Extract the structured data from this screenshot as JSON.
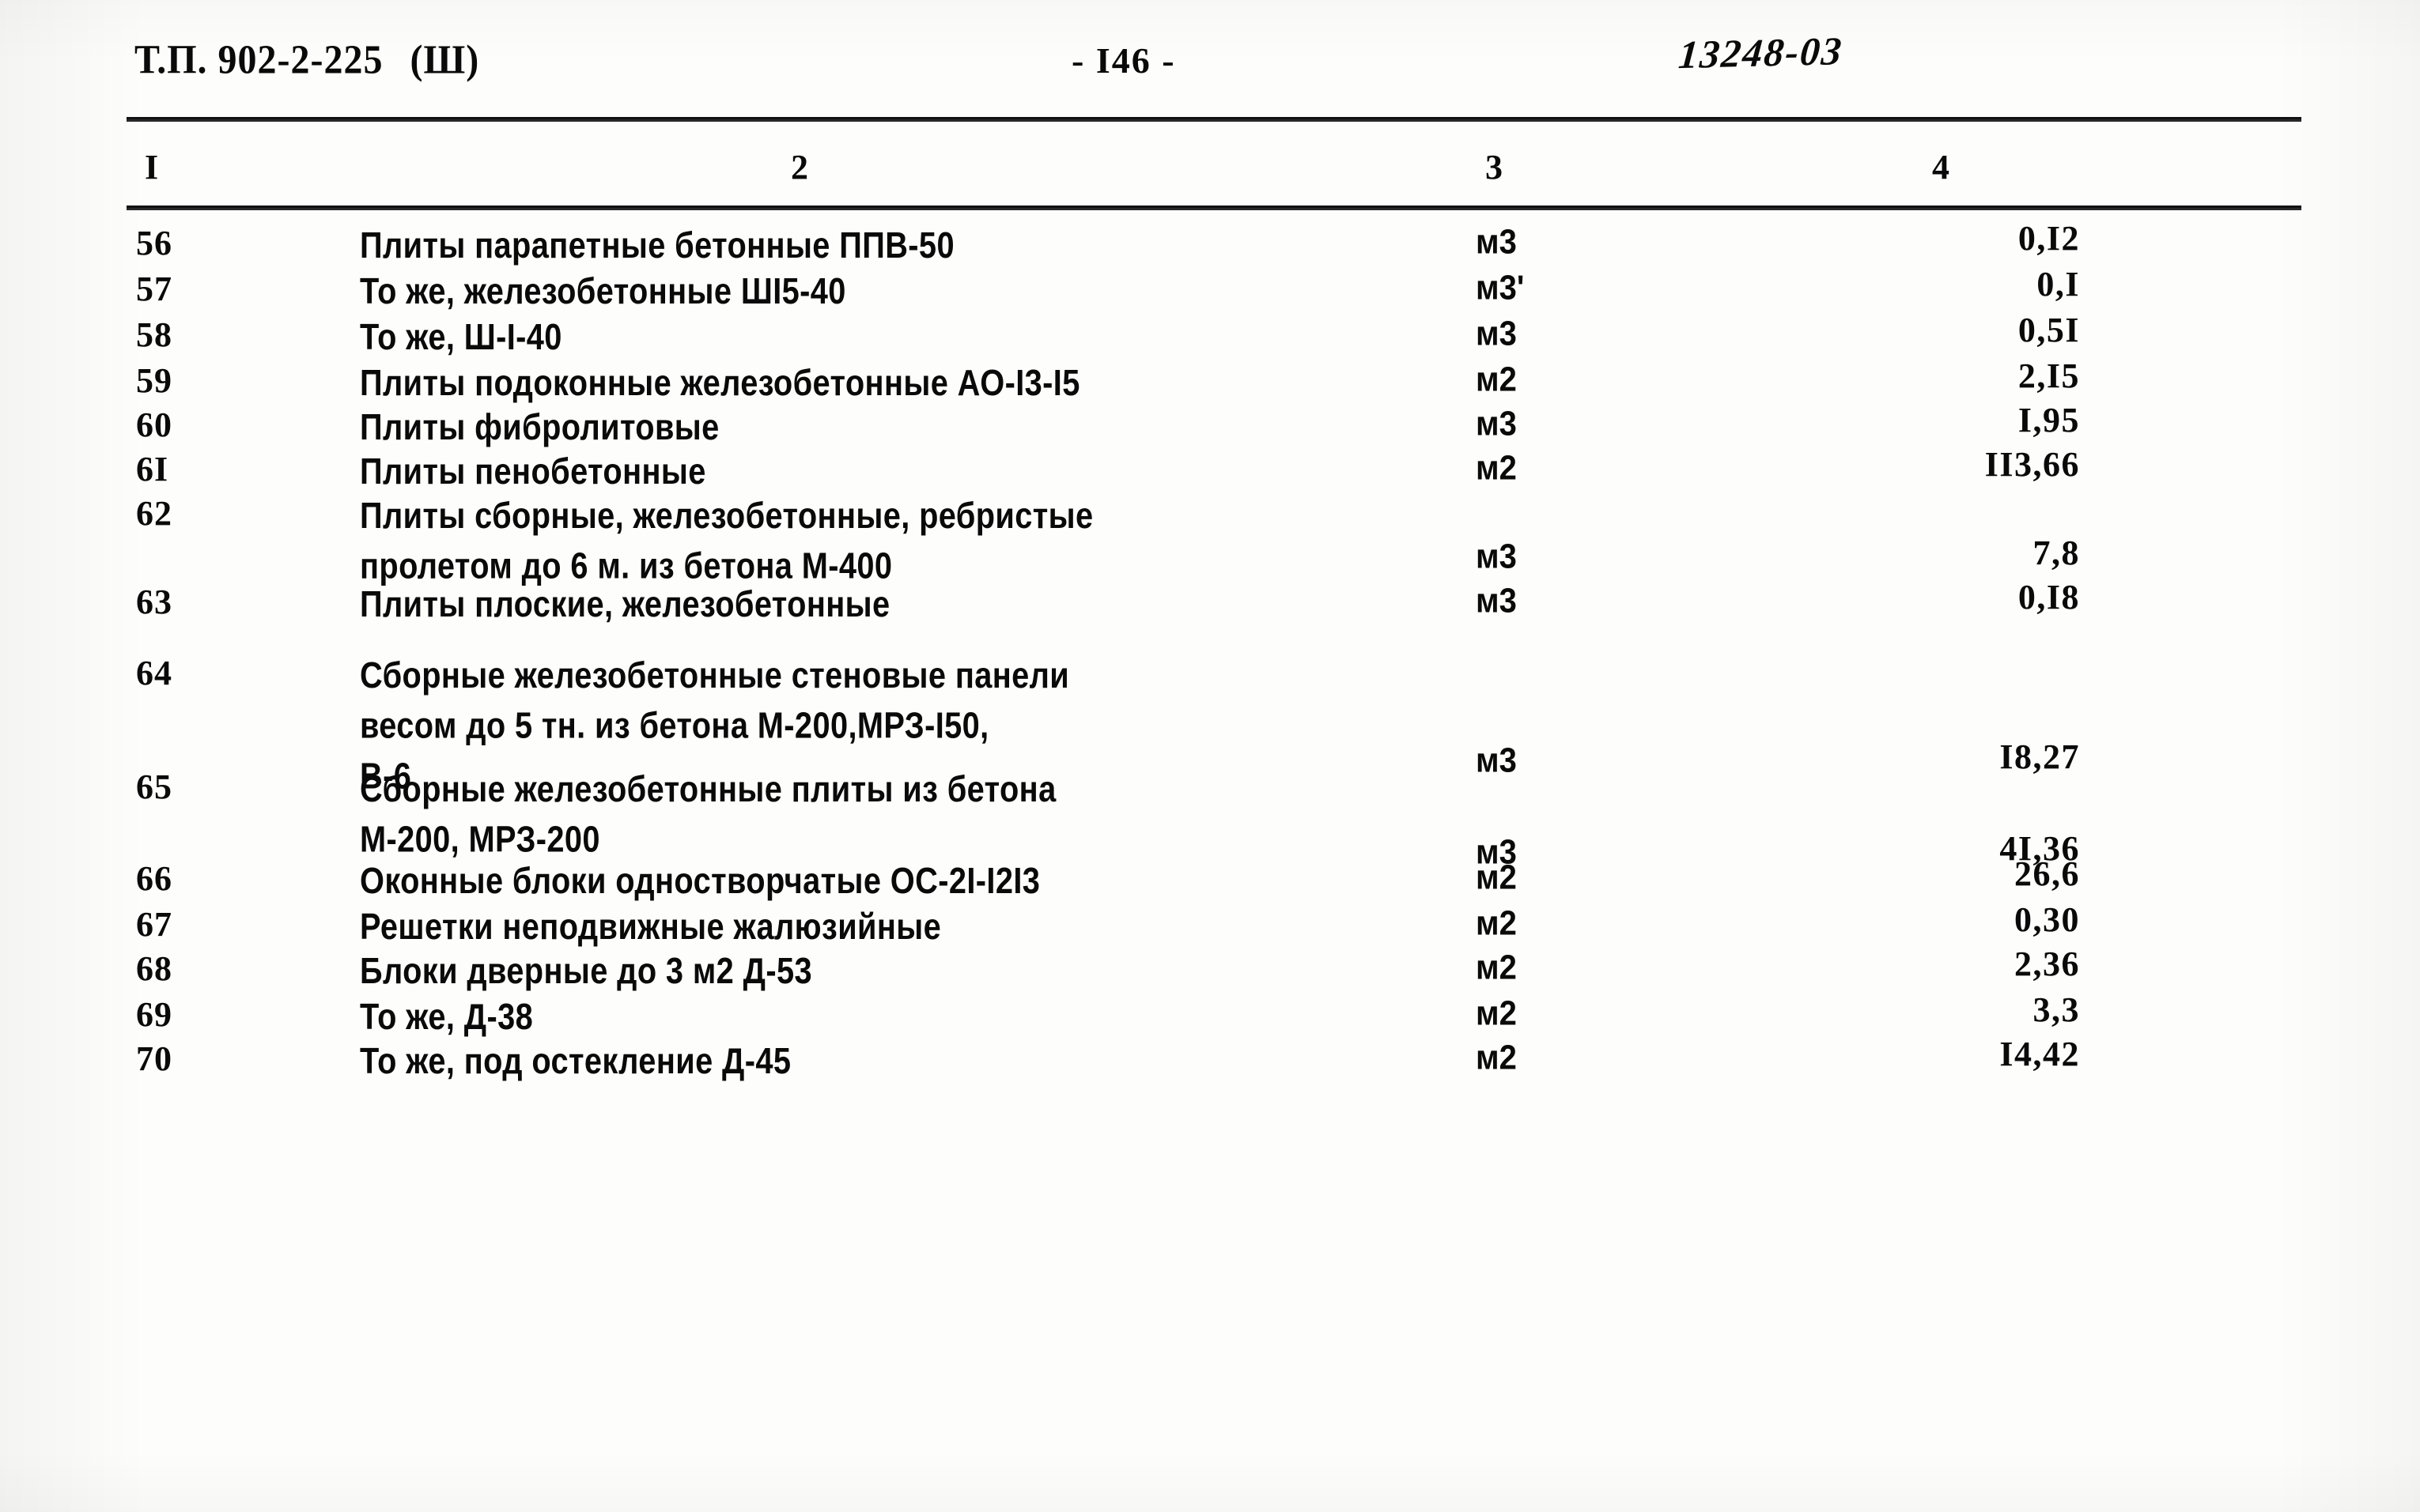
{
  "document": {
    "code_label": "Т.П. 902-2-225",
    "code_suffix": "(Ш)",
    "page_marker": "- I46 -",
    "stamp_number": "13248-03"
  },
  "table": {
    "column_headers": [
      "I",
      "2",
      "3",
      "4"
    ],
    "rows": [
      {
        "num": "56",
        "desc": [
          "Плиты парапетные бетонные ППВ-50"
        ],
        "unit": "м3",
        "value": "0,I2"
      },
      {
        "num": "57",
        "desc": [
          "То же, железобетонные ШI5-40"
        ],
        "unit": "м3'",
        "value": "0,I"
      },
      {
        "num": "58",
        "desc": [
          "То же, Ш-I-40"
        ],
        "unit": "м3",
        "value": "0,5I"
      },
      {
        "num": "59",
        "desc": [
          "Плиты подоконные железобетонные АО-I3-I5"
        ],
        "unit": "м2",
        "value": "2,I5"
      },
      {
        "num": "60",
        "desc": [
          "Плиты фибролитовые"
        ],
        "unit": "м3",
        "value": "I,95"
      },
      {
        "num": "6I",
        "desc": [
          "Плиты пенобетонные"
        ],
        "unit": "м2",
        "value": "II3,66"
      },
      {
        "num": "62",
        "desc": [
          "Плиты сборные, железобетонные, ребристые",
          "пролетом до 6 м. из бетона М-400"
        ],
        "unit": "м3",
        "value": "7,8"
      },
      {
        "num": "63",
        "desc": [
          "Плиты плоские, железобетонные"
        ],
        "unit": "м3",
        "value": "0,I8"
      },
      {
        "num": "64",
        "desc": [
          "Сборные железобетонные стеновые панели",
          "весом до 5 тн. из бетона М-200,МРЗ-I50,",
          "В-6"
        ],
        "unit": "м3",
        "value": "I8,27"
      },
      {
        "num": "65",
        "desc": [
          "Сборные железобетонные плиты из бетона",
          "М-200, МРЗ-200"
        ],
        "unit": "м3",
        "value": "4I,36"
      },
      {
        "num": "66",
        "desc": [
          "Оконные блоки одностворчатые ОС-2I-I2I3"
        ],
        "unit": "м2",
        "value": "26,6"
      },
      {
        "num": "67",
        "desc": [
          "Решетки неподвижные жалюзийные"
        ],
        "unit": "м2",
        "value": "0,30"
      },
      {
        "num": "68",
        "desc": [
          "Блоки дверные до 3 м2 Д-53"
        ],
        "unit": "м2",
        "value": "2,36"
      },
      {
        "num": "69",
        "desc": [
          "То же, Д-38"
        ],
        "unit": "м2",
        "value": "3,3"
      },
      {
        "num": "70",
        "desc": [
          "То же, под остекление Д-45"
        ],
        "unit": "м2",
        "value": "I4,42"
      }
    ]
  },
  "layout": {
    "row_tops": [
      14,
      72,
      130,
      188,
      244,
      300,
      356,
      468,
      558,
      702,
      818,
      876,
      932,
      990,
      1046
    ],
    "unit_tops": [
      14,
      72,
      130,
      188,
      244,
      300,
      412,
      468,
      670,
      786,
      818,
      876,
      932,
      990,
      1046
    ],
    "value_tops": [
      8,
      66,
      124,
      182,
      238,
      294,
      406,
      462,
      664,
      780,
      812,
      870,
      926,
      984,
      1040
    ]
  }
}
